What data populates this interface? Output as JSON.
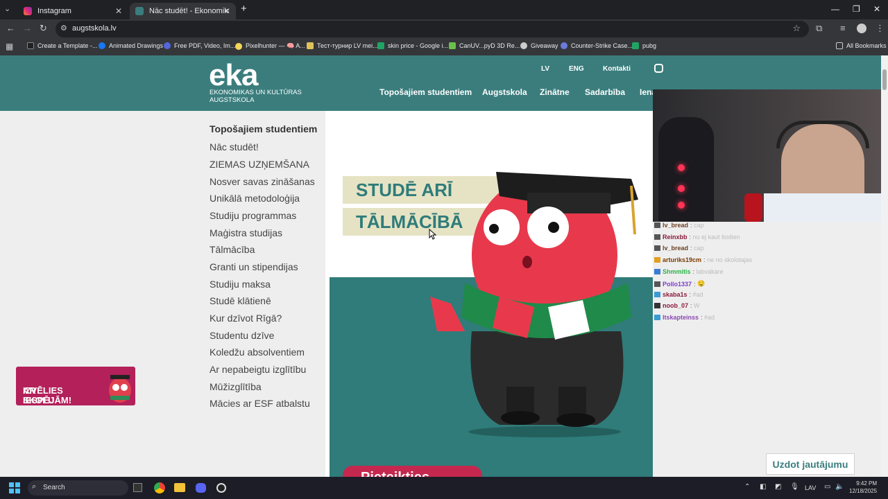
{
  "browser": {
    "tabs": [
      {
        "title": "Instagram",
        "active": false
      },
      {
        "title": "Nāc studēt! - Ekonomikas un Ku",
        "active": true
      }
    ],
    "new_tab_glyph": "+",
    "url": "augstskola.lv",
    "bookmarks": [
      "Create a Template -...",
      "Animated Drawings",
      "Free PDF, Video, Im...",
      "Pixelhunter — 🧠 A...",
      "Тест-турнир LV mei...",
      "skin price - Google i...",
      "CanUV...pyD 3D Re...",
      "Giveaway",
      "Counter-Strike Case...",
      "pubg"
    ],
    "all_bookmarks": "All Bookmarks"
  },
  "site": {
    "logo_word": "eka",
    "logo_sub": "EKONOMIKAS UN KULTŪRAS AUGSTSKOLA",
    "top_nav": [
      "LV",
      "ENG",
      "Kontakti"
    ],
    "main_nav": [
      "Topošajiem studentiem",
      "Augstskola",
      "Zinātne",
      "Sadarbība",
      "Iena"
    ],
    "sidebar_title": "Topošajiem studentiem",
    "sidebar_items": [
      "Nāc studēt!",
      "ZIEMAS UZŅEMŠANA",
      "Nosver savas zināšanas",
      "Unikālā metodoloģija",
      "Studiju programmas",
      "Maģistra studijas",
      "Tālmācība",
      "Granti un stipendijas",
      "Studiju maksa",
      "Studē klātienē",
      "Kur dzīvot Rīgā?",
      "Studentu dzīve",
      "Koledžu absolventiem",
      "Ar nepabeigtu izglītību",
      "Mūžizglītība",
      "Mācies ar ESF atbalstu"
    ],
    "promo_text": [
      "IZVĒLIES SKOLU",
      "AR IESPĒJĀM!"
    ],
    "banner_lines": [
      "STUDĒ ARĪ",
      "TĀLMĀCĪBĀ"
    ],
    "cta_label": "Pieteikties",
    "ask_button": "Uzdot jautājumu",
    "colors": {
      "teal": "#3b7d7d",
      "cream": "#e6e3c4",
      "crimson": "#c5284f"
    }
  },
  "stream_chat": [
    {
      "user": "lv_bread",
      "msg": "cap",
      "color": "#6b4226"
    },
    {
      "user": "Reinxbb",
      "msg": "nu ej kaut šodien",
      "color": "#8a1a3c"
    },
    {
      "user": "lv_bread",
      "msg": "cap",
      "color": "#6b4226"
    },
    {
      "user": "arturiks19cm",
      "msg": "ne no skolotajas",
      "color": "#7a3b00"
    },
    {
      "user": "Shmmitis",
      "msg": "labvakare",
      "color": "#2db34a"
    },
    {
      "user": "Pollo1337",
      "msg": "🤤",
      "color": "#7b3fc4"
    },
    {
      "user": "skaba1s",
      "msg": "#ad",
      "color": "#8a1a3c"
    },
    {
      "user": "noob_07",
      "msg": "W",
      "color": "#8a1a3c"
    },
    {
      "user": "Itskapteinss",
      "msg": "#ad",
      "color": "#8a4ab0"
    }
  ],
  "taskbar": {
    "search_label": "Search",
    "language": "LAV",
    "time": "9:42 PM",
    "date": "12/18/2025"
  }
}
